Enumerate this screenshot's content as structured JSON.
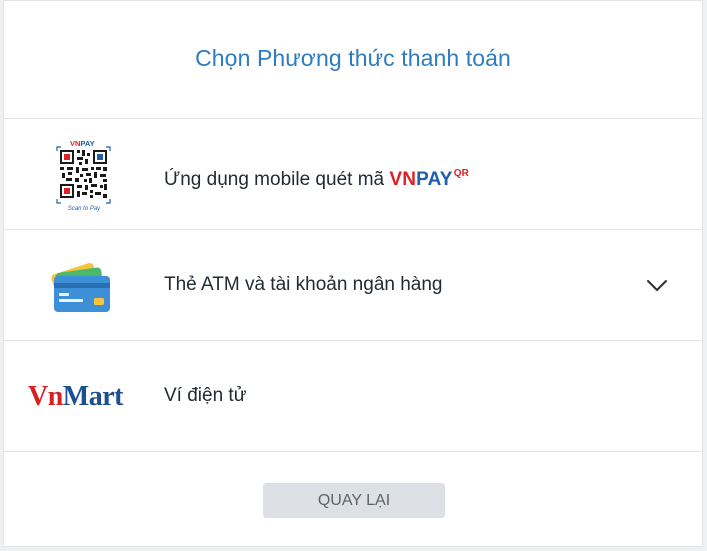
{
  "header": {
    "title": "Chọn Phương thức thanh toán"
  },
  "methods": [
    {
      "label": "Ứng dụng mobile quét mã",
      "brand_vn": "VN",
      "brand_pay": "PAY",
      "brand_sup": "QR",
      "icon": "vnpay-qr-icon",
      "icon_caption_top": "VNPAY",
      "icon_caption_bottom": "Scan to Pay"
    },
    {
      "label": "Thẻ ATM và tài khoản ngân hàng",
      "icon": "bank-cards-icon",
      "expand_icon": "chevron-down-icon"
    },
    {
      "label": "Ví điện tử",
      "logo_vn": "Vn",
      "logo_mart": "Mart"
    }
  ],
  "footer": {
    "back_label": "QUAY LẠI"
  },
  "colors": {
    "title": "#2d7cc1",
    "vnpay_red": "#e11f26",
    "vnpay_blue": "#1d5fa8",
    "vnmart_blue": "#1d4f91",
    "button_bg": "#dde1e5"
  }
}
